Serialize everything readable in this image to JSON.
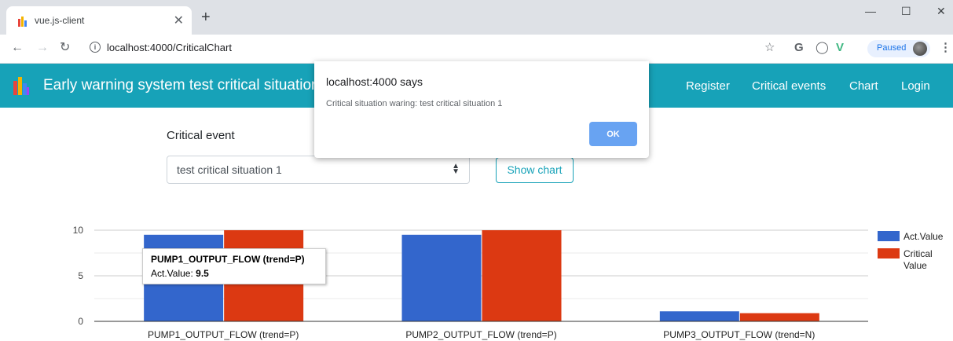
{
  "browser": {
    "tab_title": "vue.js-client",
    "url": "localhost:4000/CriticalChart",
    "profile_status": "Paused"
  },
  "navbar": {
    "brand": "Early warning system test critical situation",
    "links": [
      "Register",
      "Critical events",
      "Chart",
      "Login"
    ]
  },
  "form": {
    "label": "Critical event",
    "selected": "test critical situation 1",
    "button": "Show chart"
  },
  "dialog": {
    "title": "localhost:4000 says",
    "message": "Critical situation waring: test critical situation 1",
    "ok": "OK"
  },
  "tooltip": {
    "title": "PUMP1_OUTPUT_FLOW (trend=P)",
    "label": "Act.Value:",
    "value": "9.5"
  },
  "chart_data": {
    "type": "bar",
    "categories": [
      "PUMP1_OUTPUT_FLOW (trend=P)",
      "PUMP2_OUTPUT_FLOW (trend=P)",
      "PUMP3_OUTPUT_FLOW (trend=N)"
    ],
    "series": [
      {
        "name": "Act.Value",
        "values": [
          9.5,
          9.5,
          1.1
        ],
        "color": "#3366cc"
      },
      {
        "name": "Critical Value",
        "values": [
          10,
          10,
          0.9
        ],
        "color": "#dc3912"
      }
    ],
    "yticks": [
      "0",
      "5",
      "10"
    ],
    "ylim": [
      0,
      10
    ],
    "legend": "right",
    "grid": true
  }
}
